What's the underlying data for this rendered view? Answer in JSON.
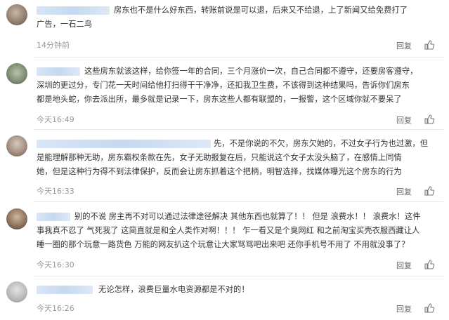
{
  "comments": [
    {
      "text": "房东也不是什么好东西，转账前说是可以退，后来又不给退，上了新闻又给免费打了\n广告，一石二鸟",
      "time": "14分钟前",
      "reply_label": "回复",
      "like_icon": "thumbs-up-icon"
    },
    {
      "text": "这些房东就该这样，给你签一年的合同，三个月涨价一次，自己合同都不遵守，还要房客遵守，\n深圳的更过分，专门花一天时间给他打扫得干干净净，还扣我卫生费，不该得到这种结果吗，告诉你们房东\n都是地头蛇，你去派出所，最多就是记录一下，房东这些人都有联盟的，一报警，这个区域你就不要呆了",
      "time": "今天16:49",
      "reply_label": "回复",
      "like_icon": "thumbs-up-icon"
    },
    {
      "text": "先，不是你说的不欠，房东欠她的，不过女子行为也过激，但\n是能理解那种无助，房东霸权条款在先，女子无助报复在后，只能说这个女子太没头脑了，在感情上同情\n她，但是这种行为得不到法律保护，反而会让房东抓着这个把柄，明智选择，找媒体曝光这个房东的行为",
      "time": "今天16:33",
      "reply_label": "回复",
      "like_icon": "thumbs-up-icon"
    },
    {
      "text": "别的不说 房主再不对可以通过法律途径解决 其他东西也就算了！！ 但是 浪费水！！ 浪费水！这件\n事我真不忍了 气死我了 这简直就是和全人类作对啊！！！ 乍一看又是个臭网红 和之前淘宝买壳衣服西藏让人\n睡一圈的那个玩意一路货色 万能的网友扒这个玩意让大家骂骂吧出来吧 还你手机号不用了 不用就没事了？",
      "time": "今天16:30",
      "reply_label": "回复",
      "like_icon": "thumbs-up-icon"
    },
    {
      "text": "无论怎样，浪费巨量水电资源都是不对的！",
      "time": "今天16:26",
      "reply_label": "回复",
      "like_icon": "thumbs-up-icon"
    }
  ]
}
